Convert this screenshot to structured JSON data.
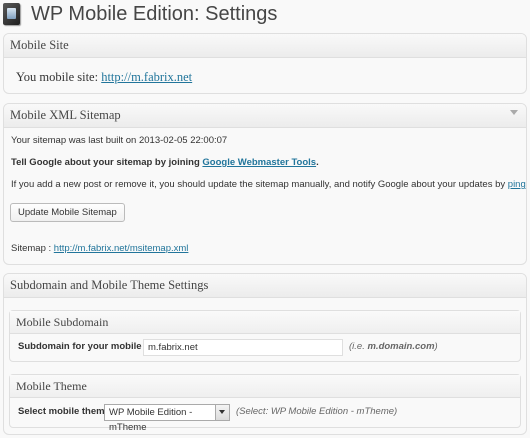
{
  "page": {
    "title": "WP Mobile Edition: Settings"
  },
  "mobile_site": {
    "heading": "Mobile Site",
    "label": "You mobile site:",
    "link": "http://m.fabrix.net"
  },
  "sitemap": {
    "heading": "Mobile XML Sitemap",
    "last_built": "Your sitemap was last built on 2013-02-05 22:00:07",
    "tell_google_prefix": "Tell Google about your sitemap by joining",
    "tell_google_link": "Google Webmaster Tools",
    "tell_google_suffix": ".",
    "notify_text": "If you add a new post or remove it, you should update the sitemap manually, and notify Google about your updates by",
    "notify_link": "pinging it",
    "button_label": "Update Mobile Sitemap",
    "sitemap_label": "Sitemap :",
    "sitemap_link": "http://m.fabrix.net/msitemap.xml"
  },
  "settings": {
    "heading": "Subdomain and Mobile Theme Settings",
    "subdomain": {
      "heading": "Mobile Subdomain",
      "label": "Subdomain for your mobile site:",
      "value": "m.fabrix.net",
      "hint_prefix": "(i.e. ",
      "hint_example": "m.domain.com",
      "hint_suffix": ")"
    },
    "theme": {
      "heading": "Mobile Theme",
      "label": "Select mobile theme :",
      "selected": "WP Mobile Edition - mTheme",
      "hint": "(Select: WP Mobile Edition - mTheme)"
    }
  },
  "colors": {
    "link": "#21759b",
    "title": "#464646",
    "background": "#f9f9f9"
  }
}
